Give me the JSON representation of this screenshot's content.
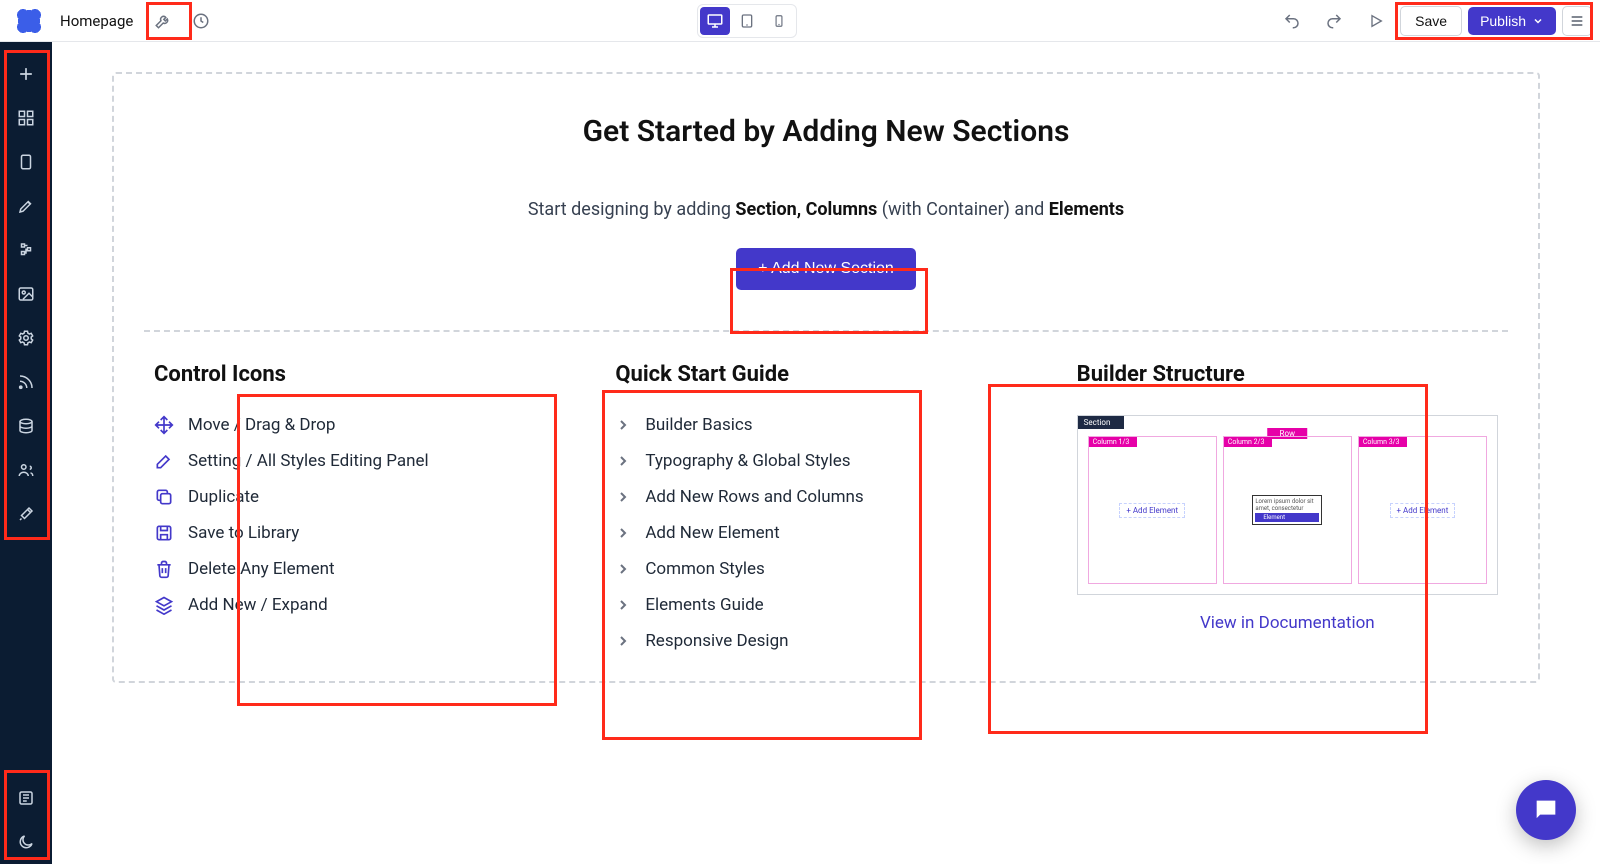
{
  "header": {
    "page_title": "Homepage",
    "save_label": "Save",
    "publish_label": "Publish"
  },
  "hero": {
    "title": "Get Started by Adding New Sections",
    "subtitle_prefix": "Start designing by adding ",
    "subtitle_bold1": "Section, Columns",
    "subtitle_mid": " (with Container) and ",
    "subtitle_bold2": "Elements",
    "add_button": "+ Add New Section"
  },
  "control_icons": {
    "title": "Control Icons",
    "items": [
      "Move / Drag & Drop",
      "Setting / All Styles Editing Panel",
      "Duplicate",
      "Save to Library",
      "Delete Any Element",
      "Add New / Expand"
    ]
  },
  "quick_start": {
    "title": "Quick Start Guide",
    "items": [
      "Builder Basics",
      "Typography & Global Styles",
      "Add New Rows and Columns",
      "Add New Element",
      "Common Styles",
      "Elements Guide",
      "Responsive Design"
    ]
  },
  "builder_structure": {
    "title": "Builder Structure",
    "section_label": "Section",
    "row_label": "Row",
    "col_label_1": "Column 1/3",
    "col_label_2": "Column 2/3",
    "col_label_3": "Column 3/3",
    "add_element": "+ Add Element",
    "element_label": "Element",
    "lorem": "Lorem ipsum dolor sit amet, consectetur",
    "doc_link": "View in Documentation"
  }
}
